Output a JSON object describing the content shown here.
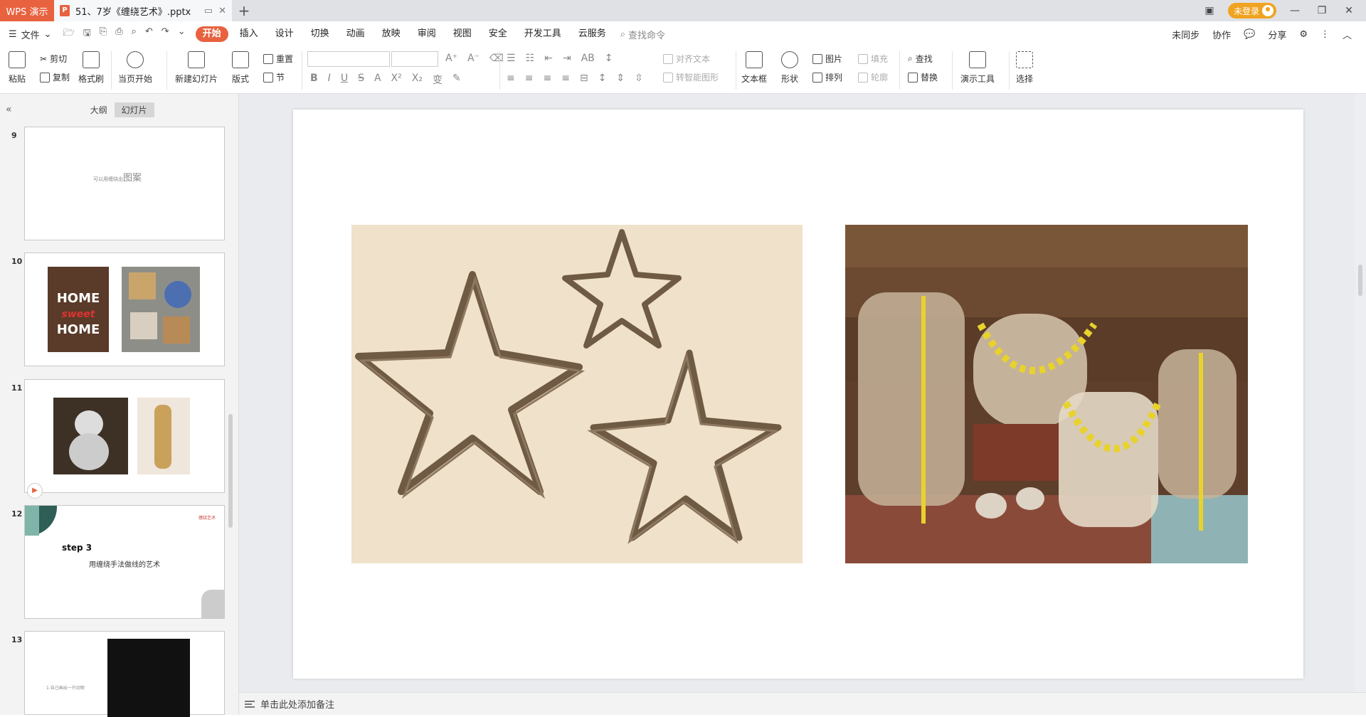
{
  "titlebar": {
    "app_tab": "WPS 演示",
    "doc_tab": "51、7岁《缠绕艺术》.pptx",
    "doc_icon": "P",
    "login": "未登录",
    "accent": "#e8623f"
  },
  "menubar": {
    "file": "文件",
    "items": [
      "开始",
      "插入",
      "设计",
      "切换",
      "动画",
      "放映",
      "审阅",
      "视图",
      "安全",
      "开发工具",
      "云服务"
    ],
    "search": "查找命令",
    "right": [
      "未同步",
      "协作",
      "分享"
    ]
  },
  "ribbon": {
    "paste": "粘贴",
    "cut": "剪切",
    "copy": "复制",
    "format_painter": "格式刷",
    "play_current": "当页开始",
    "new_slide": "新建幻灯片",
    "layout": "版式",
    "reset": "重置",
    "section": "节",
    "align_text": "对齐文本",
    "smart_shape": "转智能图形",
    "textbox": "文本框",
    "shape": "形状",
    "picture": "图片",
    "arrange": "排列",
    "fill": "填充",
    "outline": "轮廓",
    "find": "查找",
    "replace": "替换",
    "present_tools": "演示工具",
    "select": "选择"
  },
  "sidebar": {
    "tab_outline": "大纲",
    "tab_slides": "幻灯片",
    "slides": [
      {
        "num": "9",
        "small": "可以用缠绕出",
        "big": "图案"
      },
      {
        "num": "10",
        "house_line1": "HOME",
        "house_line2": "sweet",
        "house_line3": "HOME"
      },
      {
        "num": "11"
      },
      {
        "num": "12",
        "step": "step 3",
        "subtitle": "用缠绕手法做线的艺术",
        "logo": "缠绕艺术"
      },
      {
        "num": "13",
        "text": "1.自己画出一只动物"
      }
    ]
  },
  "notes": {
    "placeholder": "单击此处添加备注"
  }
}
